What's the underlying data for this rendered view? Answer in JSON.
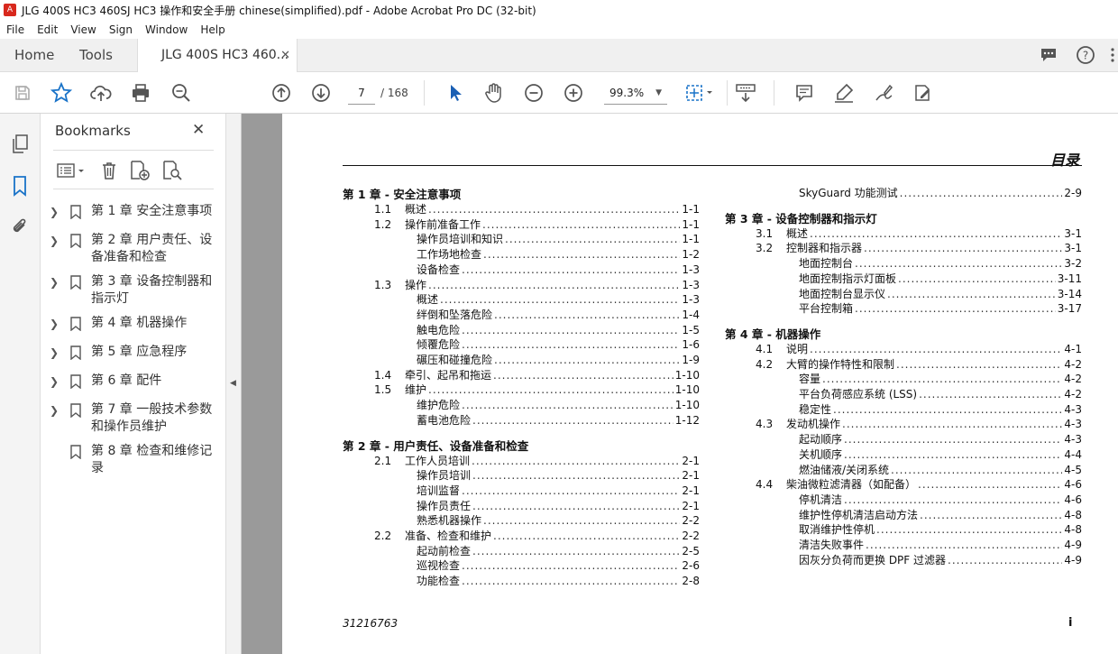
{
  "window_title": "JLG 400S HC3 460SJ HC3 操作和安全手册 chinese(simplified).pdf - Adobe Acrobat Pro DC (32-bit)",
  "menu": [
    "File",
    "Edit",
    "View",
    "Sign",
    "Window",
    "Help"
  ],
  "tabs": {
    "home": "Home",
    "tools": "Tools",
    "document": "JLG 400S HC3 460..."
  },
  "toolbar": {
    "page_current": "7",
    "page_total": "/ 168",
    "zoom": "99.3%"
  },
  "bookmarks": {
    "title": "Bookmarks",
    "items": [
      "第 1 章 安全注意事项",
      "第 2 章 用户责任、设备准备和检查",
      "第 3 章 设备控制器和指示灯",
      "第 4 章 机器操作",
      "第 5 章 应急程序",
      "第 6 章 配件",
      "第 7 章 一般技术参数和操作员维护",
      "第 8 章 检查和维修记录"
    ]
  },
  "doc": {
    "heading": "目录",
    "footer_code": "31216763",
    "footer_page": "i",
    "left_col": [
      {
        "chapter": "第 1 章 - 安全注意事项"
      },
      {
        "num": "1.1",
        "text": "概述",
        "page": "1-1"
      },
      {
        "num": "1.2",
        "text": "操作前准备工作",
        "page": "1-1"
      },
      {
        "sub": true,
        "text": "操作员培训和知识",
        "page": "1-1"
      },
      {
        "sub": true,
        "text": "工作场地检查",
        "page": "1-2"
      },
      {
        "sub": true,
        "text": "设备检查",
        "page": "1-3"
      },
      {
        "num": "1.3",
        "text": "操作",
        "page": "1-3"
      },
      {
        "sub": true,
        "text": "概述",
        "page": "1-3"
      },
      {
        "sub": true,
        "text": "绊倒和坠落危险",
        "page": "1-4"
      },
      {
        "sub": true,
        "text": "触电危险",
        "page": "1-5"
      },
      {
        "sub": true,
        "text": "倾覆危险",
        "page": "1-6"
      },
      {
        "sub": true,
        "text": "碾压和碰撞危险",
        "page": "1-9"
      },
      {
        "num": "1.4",
        "text": "牵引、起吊和拖运",
        "page": "1-10"
      },
      {
        "num": "1.5",
        "text": "维护",
        "page": "1-10"
      },
      {
        "sub": true,
        "text": "维护危险",
        "page": "1-10"
      },
      {
        "sub": true,
        "text": "蓄电池危险",
        "page": "1-12"
      },
      {
        "chapter": "第 2 章 - 用户责任、设备准备和检查"
      },
      {
        "num": "2.1",
        "text": "工作人员培训",
        "page": "2-1"
      },
      {
        "sub": true,
        "text": "操作员培训",
        "page": "2-1"
      },
      {
        "sub": true,
        "text": "培训监督",
        "page": "2-1"
      },
      {
        "sub": true,
        "text": "操作员责任",
        "page": "2-1"
      },
      {
        "sub": true,
        "text": "熟悉机器操作",
        "page": "2-2"
      },
      {
        "num": "2.2",
        "text": "准备、检查和维护",
        "page": "2-2"
      },
      {
        "sub": true,
        "text": "起动前检查",
        "page": "2-5"
      },
      {
        "sub": true,
        "text": "巡视检查",
        "page": "2-6"
      },
      {
        "sub": true,
        "text": "功能检查",
        "page": "2-8"
      }
    ],
    "right_col": [
      {
        "sub": true,
        "text": "SkyGuard 功能测试",
        "page": "2-9"
      },
      {
        "chapter": "第 3 章 - 设备控制器和指示灯"
      },
      {
        "num": "3.1",
        "text": "概述",
        "page": "3-1"
      },
      {
        "num": "3.2",
        "text": "控制器和指示器",
        "page": "3-1"
      },
      {
        "sub": true,
        "text": "地面控制台",
        "page": "3-2"
      },
      {
        "sub": true,
        "text": "地面控制指示灯面板",
        "page": "3-11"
      },
      {
        "sub": true,
        "text": "地面控制台显示仪",
        "page": "3-14"
      },
      {
        "sub": true,
        "text": "平台控制箱",
        "page": "3-17"
      },
      {
        "chapter": "第 4 章 - 机器操作"
      },
      {
        "num": "4.1",
        "text": "说明",
        "page": "4-1"
      },
      {
        "num": "4.2",
        "text": "大臂的操作特性和限制",
        "page": "4-2"
      },
      {
        "sub": true,
        "text": "容量",
        "page": "4-2"
      },
      {
        "sub": true,
        "text": "平台负荷感应系统 (LSS)",
        "page": "4-2"
      },
      {
        "sub": true,
        "text": "稳定性",
        "page": "4-3"
      },
      {
        "num": "4.3",
        "text": "发动机操作",
        "page": "4-3"
      },
      {
        "sub": true,
        "text": "起动顺序",
        "page": "4-3"
      },
      {
        "sub": true,
        "text": "关机顺序",
        "page": "4-4"
      },
      {
        "sub": true,
        "text": "燃油储液/关闭系统",
        "page": "4-5"
      },
      {
        "num": "4.4",
        "text": "柴油微粒滤清器（如配备）",
        "page": "4-6"
      },
      {
        "sub": true,
        "text": "停机清洁",
        "page": "4-6"
      },
      {
        "sub": true,
        "text": "维护性停机清洁启动方法",
        "page": "4-8"
      },
      {
        "sub": true,
        "text": "取消维护性停机",
        "page": "4-8"
      },
      {
        "sub": true,
        "text": "清洁失败事件",
        "page": "4-9"
      },
      {
        "sub": true,
        "text": "因灰分负荷而更换 DPF 过滤器",
        "page": "4-9"
      }
    ]
  }
}
